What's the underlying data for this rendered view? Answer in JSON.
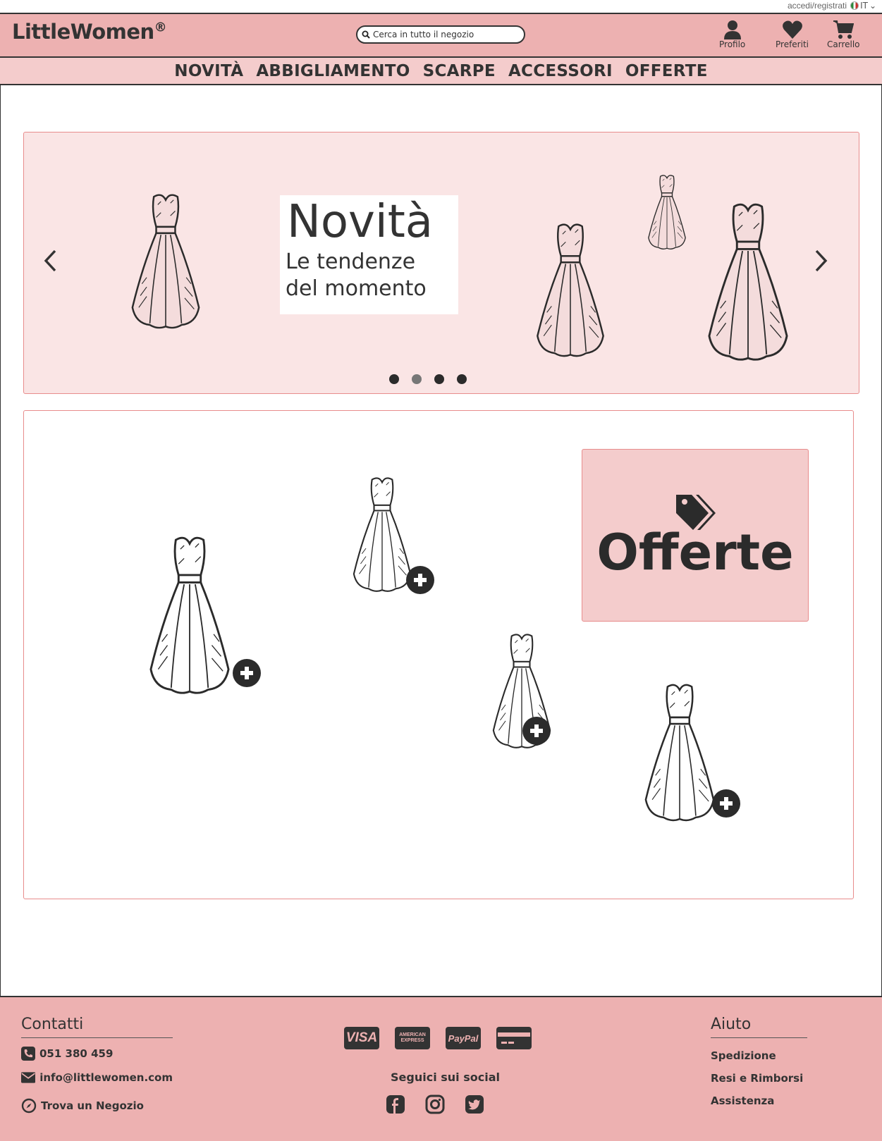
{
  "utility": {
    "login": "accedi/registrati",
    "lang": "IT"
  },
  "header": {
    "logo": "LittleWomen",
    "logo_mark": "®",
    "search_placeholder": "Cerca in tutto il negozio",
    "actions": [
      {
        "label": "Profilo",
        "icon": "user-icon"
      },
      {
        "label": "Preferiti",
        "icon": "heart-icon"
      },
      {
        "label": "Carrello",
        "icon": "cart-icon"
      }
    ]
  },
  "nav": {
    "items": [
      "NOVITÀ",
      "ABBIGLIAMENTO",
      "SCARPE",
      "ACCESSORI",
      "OFFERTE"
    ]
  },
  "hero": {
    "title": "Novità",
    "subtitle_line1": "Le tendenze",
    "subtitle_line2": "del momento",
    "slides": 4,
    "active_slide": 2
  },
  "offers": {
    "card_title": "Offerte",
    "card_icon": "tags-icon"
  },
  "footer": {
    "contacts_title": "Contatti",
    "phone": "051 380 459",
    "email": "info@littlewomen.com",
    "store": "Trova un Negozio",
    "payments": [
      "VISA",
      "AMERICAN EXPRESS",
      "PayPal",
      "card"
    ],
    "social_title": "Seguici sui social",
    "socials": [
      "facebook-icon",
      "instagram-icon",
      "twitter-icon"
    ],
    "help_title": "Aiuto",
    "help_links": [
      "Spedizione",
      "Resi e Rimborsi",
      "Assistenza"
    ]
  },
  "colors": {
    "header": "#edb1b1",
    "nav": "#f4cccc",
    "hero": "#fae5e5",
    "border": "#e88c8c",
    "dark": "#2b2b2b"
  }
}
